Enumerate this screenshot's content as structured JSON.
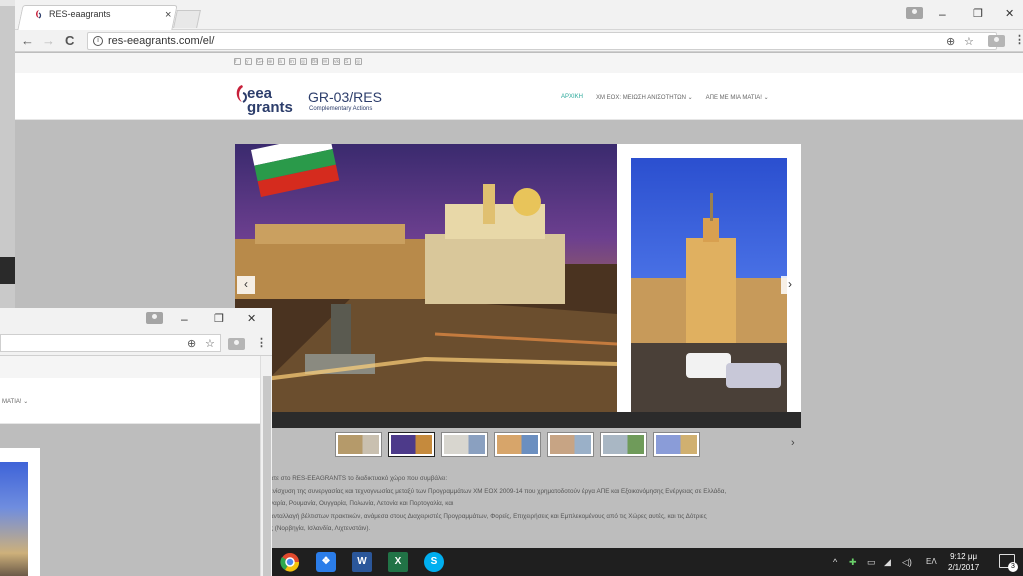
{
  "main_window": {
    "tab_title": "RES-eaagrants",
    "tab_close": "×",
    "url": "res-eeagrants.com/el/",
    "controls": {
      "minimize": "–",
      "restore": "❐",
      "close": "✕"
    },
    "nav": {
      "back": "←",
      "forward": "→",
      "reload": "C"
    },
    "omnibox_icons": {
      "zoom": "⊕",
      "star": "☆",
      "menu": "⋮"
    }
  },
  "site": {
    "social_icons": [
      "f",
      "y",
      "G+",
      "⊕",
      "ä",
      "in",
      "◎",
      "Bē",
      "✉",
      "vk",
      "S",
      "◎"
    ],
    "logo": {
      "eea": "eea",
      "grants": "grants",
      "title": "GR-03/RES",
      "subtitle": "Complementary Actions"
    },
    "nav": [
      "ΑΡΧΙΚΗ",
      "ΧΜ ΕΟΧ: ΜΕΙΩΣΗ ΑΝΙΣΟΤΗΤΩΝ ⌄",
      "ΑΠΕ ΜΕ ΜΙΑ ΜΑΤΙΑ! ⌄"
    ],
    "carousel": {
      "prev": "‹",
      "next": "›",
      "thumb_next": "›"
    },
    "thumb_colors": [
      [
        "#b59a6a",
        "#c9c0b0"
      ],
      [
        "#4d3a8a",
        "#c58a3d"
      ],
      [
        "#d8d6cf",
        "#8aa0c0"
      ],
      [
        "#d7a56a",
        "#6b8fc0"
      ],
      [
        "#c7a484",
        "#9ab0c8"
      ],
      [
        "#a9b7c4",
        "#6f9b5a"
      ],
      [
        "#8a9cd8",
        "#d0b070"
      ]
    ],
    "text_lines": [
      "ατε στο RES-EEAGRANTS το διαδικτυακό χώρο που συμβάλει:",
      "ενίσχυση της συνεργασίας και τεχνογνωσίας μεταξύ των Προγραμμάτων ΧΜ ΕΟΧ 2009-14 που χρηματοδοτούν έργα ΑΠΕ και Εξοικονόμησης Ενέργειας σε Ελλάδα,",
      "γαρία, Ρουμανία, Ουγγαρία, Πολωνία, Λετονία και Πορτογαλία, και",
      "ανταλλαγή βέλτιστων πρακτικών, ανάμεσα στους Διαχειριστές Προγραμμάτων, Φορείς, Επιχειρήσεις και Εμπλεκομένους από τις Χώρες αυτές, και τις Δότριες",
      "ς (Νορβηγία, Ισλανδία, Λιχτενστάιν)."
    ]
  },
  "second_window": {
    "controls": {
      "minimize": "–",
      "restore": "❐",
      "close": "✕"
    },
    "nav_fragment": "ΜΑΤΙΑ! ⌄",
    "omnibox_icons": {
      "zoom": "⊕",
      "star": "☆",
      "menu": "⋮"
    }
  },
  "taskbar": {
    "apps": [
      {
        "name": "chrome",
        "label": "",
        "color": "#e24a2e"
      },
      {
        "name": "dropbox",
        "label": "❖",
        "color": "#2b7de9"
      },
      {
        "name": "word",
        "label": "W",
        "color": "#2b579a"
      },
      {
        "name": "excel",
        "label": "X",
        "color": "#217346"
      },
      {
        "name": "skype",
        "label": "S",
        "color": "#00aff0"
      }
    ],
    "tray": {
      "chevron": "^",
      "lang": "ΕΛ"
    },
    "time": "9:12 μμ",
    "date": "2/1/2017",
    "notifications": "3"
  }
}
